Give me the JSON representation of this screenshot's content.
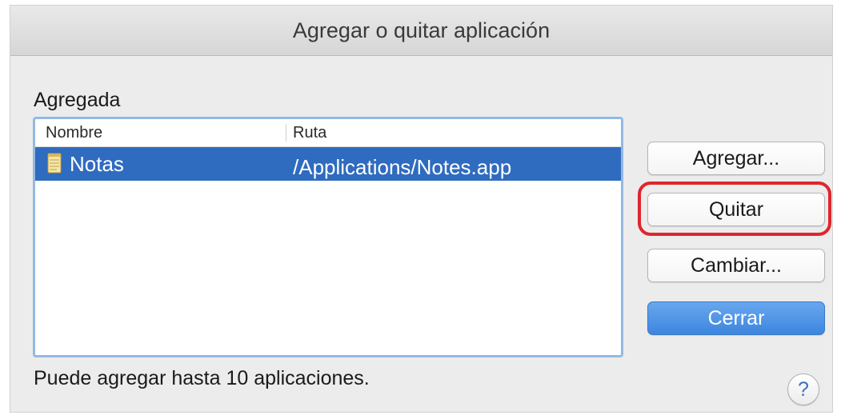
{
  "window": {
    "title": "Agregar o quitar aplicación"
  },
  "list": {
    "section_label": "Agregada",
    "columns": [
      "Nombre",
      "Ruta"
    ],
    "rows": [
      {
        "name": "Notas",
        "path": "/Applications/Notes.app",
        "icon": "notes-app-icon",
        "selected": true
      }
    ]
  },
  "buttons": {
    "add": "Agregar...",
    "remove": "Quitar",
    "change": "Cambiar...",
    "close": "Cerrar",
    "help": "?"
  },
  "hint": "Puede agregar hasta 10 aplicaciones.",
  "colors": {
    "selection": "#2f6bbf",
    "highlight": "#e0252d",
    "primary_button": "#3d86de"
  }
}
